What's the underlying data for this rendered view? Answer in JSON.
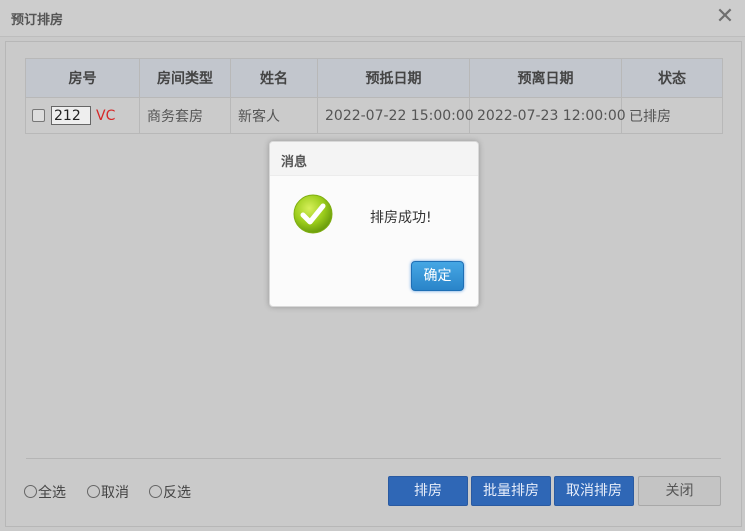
{
  "window": {
    "title": "预订排房",
    "close_glyph": "✕"
  },
  "table": {
    "headers": [
      "房号",
      "房间类型",
      "姓名",
      "预抵日期",
      "预离日期",
      "状态"
    ],
    "rows": [
      {
        "checked": false,
        "room_no": "212",
        "room_flag": "VC",
        "room_type": "商务套房",
        "guest_name": "新客人",
        "arrival": "2022-07-22 15:00:00",
        "departure": "2022-07-23 12:00:00",
        "status": "已排房"
      }
    ]
  },
  "footer": {
    "select_all": "全选",
    "cancel_select": "取消",
    "invert_select": "反选",
    "buttons": {
      "assign": "排房",
      "batch_assign": "批量排房",
      "cancel_assign": "取消排房",
      "close": "关闭"
    }
  },
  "dialog": {
    "title": "消息",
    "message": "排房成功!",
    "ok_label": "确定",
    "icon": "success-check-icon"
  },
  "colors": {
    "status_red": "#d62727",
    "primary_blue": "#2f67b6",
    "dialog_button_blue": "#2a84c9",
    "success_green": "#8ac40f"
  }
}
